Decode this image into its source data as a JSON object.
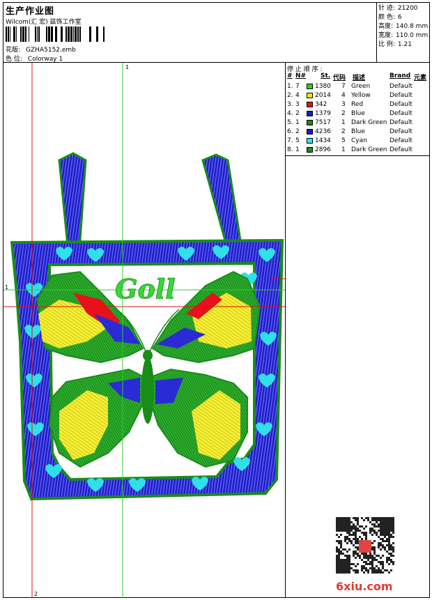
{
  "header": {
    "title": "生产作业图",
    "studio": "Wilcom(汇 宏) 兹饰工作室",
    "design_label": "花版:",
    "design_value": "GZHA5152.emb",
    "colorway_label": "色 位:",
    "colorway_value": "Colorway 1"
  },
  "specs": [
    {
      "label": "针 迹:",
      "value": "21200"
    },
    {
      "label": "颜 色:",
      "value": "6"
    },
    {
      "label": "高度:",
      "value": "140.8 mm"
    },
    {
      "label": "宽度:",
      "value": "110.0 mm"
    },
    {
      "label": "比 例:",
      "value": "1.21"
    }
  ],
  "canvas": {
    "guide_top": "1",
    "guide_left": "1",
    "guide_bottom": "2",
    "embroidery_text": "Goll"
  },
  "stop_sequence": {
    "title": "停 止 顺 序 :",
    "columns": {
      "num": "#",
      "needle": "N#",
      "stitches": "St.",
      "code": "代码",
      "desc": "描述",
      "brand": "Brand",
      "element": "元素"
    },
    "rows": [
      {
        "num": "1.",
        "needle": "7",
        "color": "#33cc33",
        "stitches": "1380",
        "code": "7",
        "desc": "Green",
        "brand": "Default"
      },
      {
        "num": "2.",
        "needle": "4",
        "color": "#f2e600",
        "stitches": "2014",
        "code": "4",
        "desc": "Yellow",
        "brand": "Default"
      },
      {
        "num": "3.",
        "needle": "3",
        "color": "#e8101a",
        "stitches": "342",
        "code": "3",
        "desc": "Red",
        "brand": "Default"
      },
      {
        "num": "4.",
        "needle": "2",
        "color": "#1a1acc",
        "stitches": "1379",
        "code": "2",
        "desc": "Blue",
        "brand": "Default"
      },
      {
        "num": "5.",
        "needle": "1",
        "color": "#1a8c1a",
        "stitches": "7517",
        "code": "1",
        "desc": "Dark Green",
        "brand": "Default"
      },
      {
        "num": "6.",
        "needle": "2",
        "color": "#1a1acc",
        "stitches": "4236",
        "code": "2",
        "desc": "Blue",
        "brand": "Default"
      },
      {
        "num": "7.",
        "needle": "5",
        "color": "#33e6e6",
        "stitches": "1434",
        "code": "5",
        "desc": "Cyan",
        "brand": "Default"
      },
      {
        "num": "8.",
        "needle": "1",
        "color": "#1a8c1a",
        "stitches": "2896",
        "code": "1",
        "desc": "Dark Green",
        "brand": "Default"
      }
    ]
  },
  "watermark": "6xiu.com"
}
